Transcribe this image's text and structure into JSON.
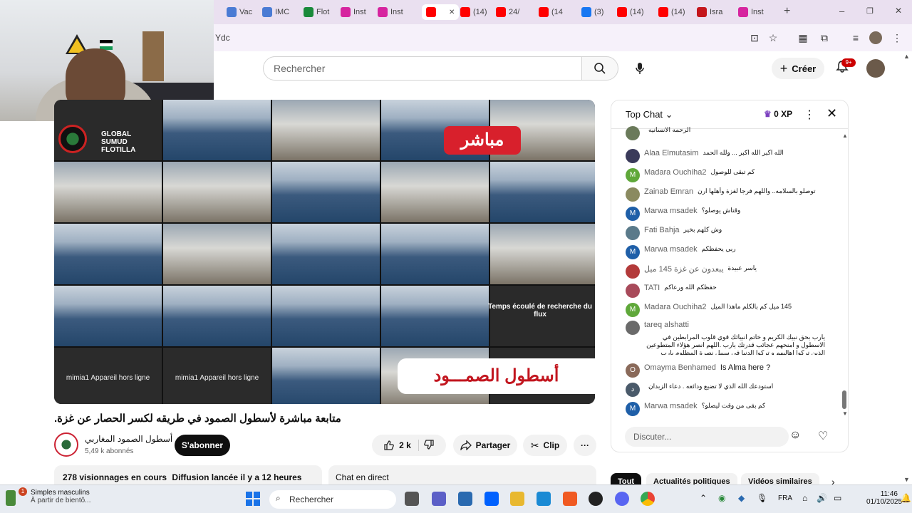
{
  "browser": {
    "tabs": [
      {
        "label": "Vac",
        "color": "#4a7bd4"
      },
      {
        "label": "IMC",
        "color": "#4a7bd4"
      },
      {
        "label": "Flot",
        "color": "#1a8a3a"
      },
      {
        "label": "Inst",
        "color": "#d6249f"
      },
      {
        "label": "Inst",
        "color": "#d6249f"
      },
      {
        "label": "",
        "color": "#ff0000"
      },
      {
        "label": "(14)",
        "color": "#ff0000"
      },
      {
        "label": "24/",
        "color": "#ff0000"
      },
      {
        "label": "(14",
        "color": "#ff0000"
      },
      {
        "label": "(3)",
        "color": "#1877f2"
      },
      {
        "label": "(14)",
        "color": "#ff0000"
      },
      {
        "label": "(14)",
        "color": "#ff0000"
      },
      {
        "label": "Isra",
        "color": "#c4161c"
      },
      {
        "label": "Inst",
        "color": "#d6249f"
      }
    ],
    "new_tab": "+",
    "url_fragment": "Ydc",
    "window_controls": {
      "minimize": "–",
      "restore": "❐",
      "close": "✕"
    }
  },
  "youtube": {
    "search_placeholder": "Rechercher",
    "create_label": "Créer",
    "notif_badge": "9+"
  },
  "video": {
    "logo_lines": [
      "GLOBAL",
      "SUMUD",
      "FLOTILLA"
    ],
    "live_badge": "مباشر",
    "overlay_title": "أسطول الصمـــود",
    "offline_1": "mimia1 Appareil hors ligne",
    "offline_2": "mimia1 Appareil hors ligne",
    "search_flux": "Temps écoulé de recherche du flux",
    "title": ".متابعة مباشرة لأسطول الصمود في طريقه لكسر الحصار عن غزة",
    "channel_name": "أسطول الصمود المغاربي",
    "subscribers": "5,49 k abonnés",
    "subscribe_label": "S'abonner",
    "likes": "2 k",
    "share_label": "Partager",
    "clip_label": "Clip",
    "more_label": "···",
    "views": "278 visionnages en cours",
    "started": "Diffusion lancée il y a 12 heures",
    "live_chat_label": "Chat en direct"
  },
  "chat": {
    "mode": "Top Chat",
    "xp": "0 XP",
    "input_placeholder": "Discuter...",
    "messages": [
      {
        "author": "",
        "text": "الرحمه الانسانيه",
        "avatar": "",
        "color": "#6a7a5a"
      },
      {
        "author": "Alaa Elmutasim",
        "text": "الله اكبر الله اكبر ... ولله الحمد",
        "avatar": "",
        "color": "#3a3a5a"
      },
      {
        "author": "Madara Ouchiha2",
        "text": "كم تبقى للوصول",
        "avatar": "M",
        "color": "#5fa83a"
      },
      {
        "author": "Zainab Emran",
        "text": "توصلو بالسلامه.. واللهم فرجا لغزة وأهلها ارن",
        "avatar": "",
        "color": "#8a8a60"
      },
      {
        "author": "Marwa msadek",
        "text": "وقتاش يوصلو؟",
        "avatar": "M",
        "color": "#1f5fa8"
      },
      {
        "author": "Fati Bahja",
        "text": "وش كلهم بخير",
        "avatar": "",
        "color": "#5a7a8a"
      },
      {
        "author": "Marwa msadek",
        "text": "ربي يحفظكم",
        "avatar": "M",
        "color": "#1f5fa8"
      },
      {
        "author": "يبعدون عن غزة 145 ميل",
        "text": "ياسر عبيدة",
        "avatar": "",
        "color": "#b33a3a"
      },
      {
        "author": "TATI",
        "text": "حفظكم الله ورعاكم",
        "avatar": "",
        "color": "#a84a5a"
      },
      {
        "author": "Madara Ouchiha2",
        "text": "145 ميل كم بالكلم ماهذا الميل",
        "avatar": "M",
        "color": "#5fa83a"
      },
      {
        "author": "tareq alshatti",
        "text": "يارب بحق نبيك الكريم و خاتم انبيائك قوي قلوب المرابطين في الاسطول و امنحهم عجائب قدرتك يارب .اللهم انصر هؤلاء المتطوعين الذين تركوا اهاليهم و تركوا الدنيا في سبيل نصرة المظلوم يارب جازهم احسانا",
        "avatar": "",
        "color": "#6a6a6a"
      },
      {
        "author": "Omayma Benhamed",
        "text": "Is Alma here ?",
        "avatar": "O",
        "color": "#8a6a5a"
      },
      {
        "author": "",
        "text": "استودعك الله الذي لا تضيع ودائعه . دعاء الزبدان",
        "avatar": "د",
        "color": "#4a5a6a"
      },
      {
        "author": "Marwa msadek",
        "text": "كم بقى من وقت ليصلو؟",
        "avatar": "M",
        "color": "#1f5fa8"
      }
    ]
  },
  "chips": [
    "Tout",
    "Actualités politiques",
    "Vidéos similaires"
  ],
  "taskbar": {
    "notification_title": "Simples masculins",
    "notification_sub": "À partir de bientô...",
    "notification_count": "1",
    "search_label": "Rechercher",
    "language": "FRA",
    "time": "11:46",
    "date": "01/10/2025"
  }
}
